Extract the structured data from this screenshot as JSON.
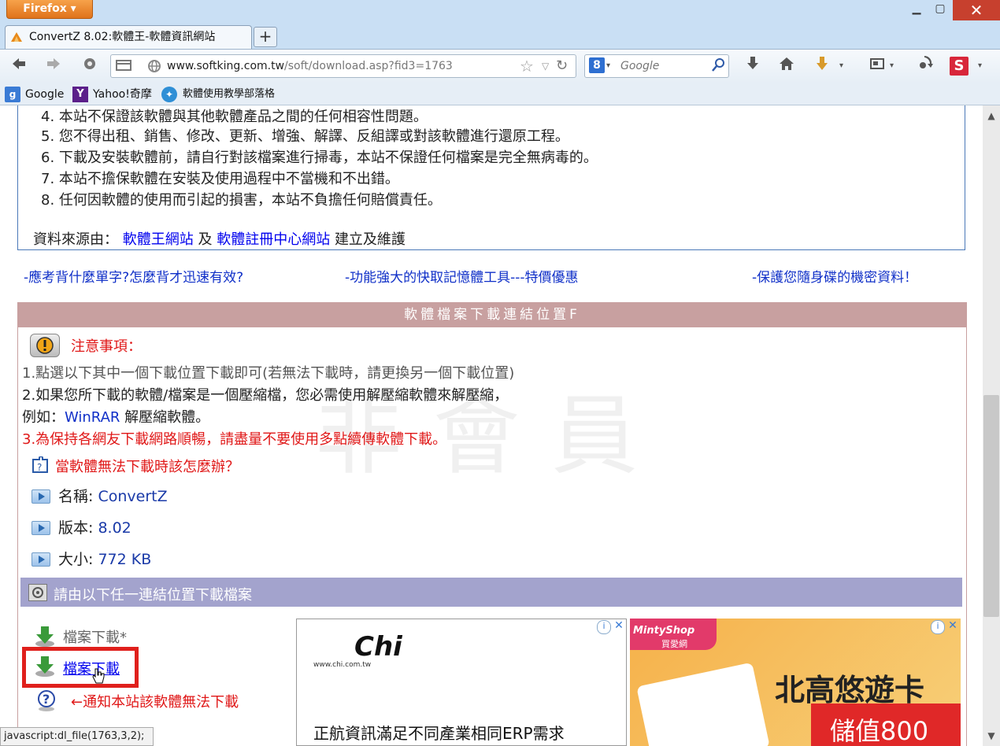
{
  "window": {
    "firefox_label": "Firefox ▾",
    "minimize": "▁",
    "maximize": "▢",
    "close": "✕"
  },
  "tab": {
    "title": "ConvertZ 8.02:軟體王-軟體資訊網站",
    "new_tab": "+"
  },
  "nav": {
    "url_host": "www.softking.com.tw",
    "url_path": "/soft/download.asp?fid3=1763",
    "search_placeholder": "Google",
    "search_engine": "8"
  },
  "bookmarks": [
    {
      "label": "Google"
    },
    {
      "label": "Yahoo!奇摩"
    },
    {
      "label": "軟體使用教學部落格"
    }
  ],
  "terms": {
    "items": [
      "4.  本站不保證該軟體與其他軟體產品之間的任何相容性問題。",
      "5.  您不得出租、銷售、修改、更新、增強、解譯、反組譯或對該軟體進行還原工程。",
      "6.  下載及安裝軟體前，請自行對該檔案進行掃毒，本站不保證任何檔案是完全無病毒的。",
      "7.  本站不擔保軟體在安裝及使用過程中不當機和不出錯。",
      "8.  任何因軟體的使用而引起的損害，本站不負擔任何賠償責任。"
    ],
    "source_prefix": "資料來源由：",
    "source_link1": "軟體王網站",
    "source_and": "及",
    "source_link2": "軟體註冊中心網站",
    "source_suffix": "建立及維護"
  },
  "promos": [
    "-應考背什麼單字?怎麼背才迅速有效?",
    "-功能強大的快取記憶體工具---特價優惠",
    "-保護您隨身碟的機密資料！"
  ],
  "download_section": {
    "header": "軟體檔案下載連結位置F",
    "notice_title": "注意事項：",
    "note1": "1.點選以下其中一個下載位置下載即可(若無法下載時，請更換另一個下載位置)",
    "note2": "2.如果您所下載的軟體/檔案是一個壓縮檔，您必需使用解壓縮軟體來解壓縮，",
    "note3_prefix": "例如：",
    "note3_link": "WinRAR",
    "note3_suffix": "解壓縮軟體。",
    "note4": "3.為保持各網友下載網路順暢，請盡量不要使用多點續傳軟體下載。",
    "help_link": "當軟體無法下載時該怎麼辦？",
    "name_label": "名稱:",
    "name_value": "ConvertZ",
    "version_label": "版本:",
    "version_value": "8.02",
    "size_label": "大小:",
    "size_value": "772 KB",
    "watermark": "非會員",
    "links_header": "請由以下任一連結位置下載檔案",
    "download1": "檔案下載*",
    "download2": "檔案下載",
    "report": "←通知本站該軟體無法下載"
  },
  "ads": {
    "ad1_logo": "Chi",
    "ad1_url": "www.chi.com.tw",
    "ad1_text": "正航資訊滿足不同產業相同ERP需求",
    "ad2_brand": "MintyShop",
    "ad2_brand_sub": "買愛網",
    "ad2_title": "北高悠遊卡",
    "ad2_price": "儲值800"
  },
  "status_text": "javascript:dl_file(1763,3,2);"
}
